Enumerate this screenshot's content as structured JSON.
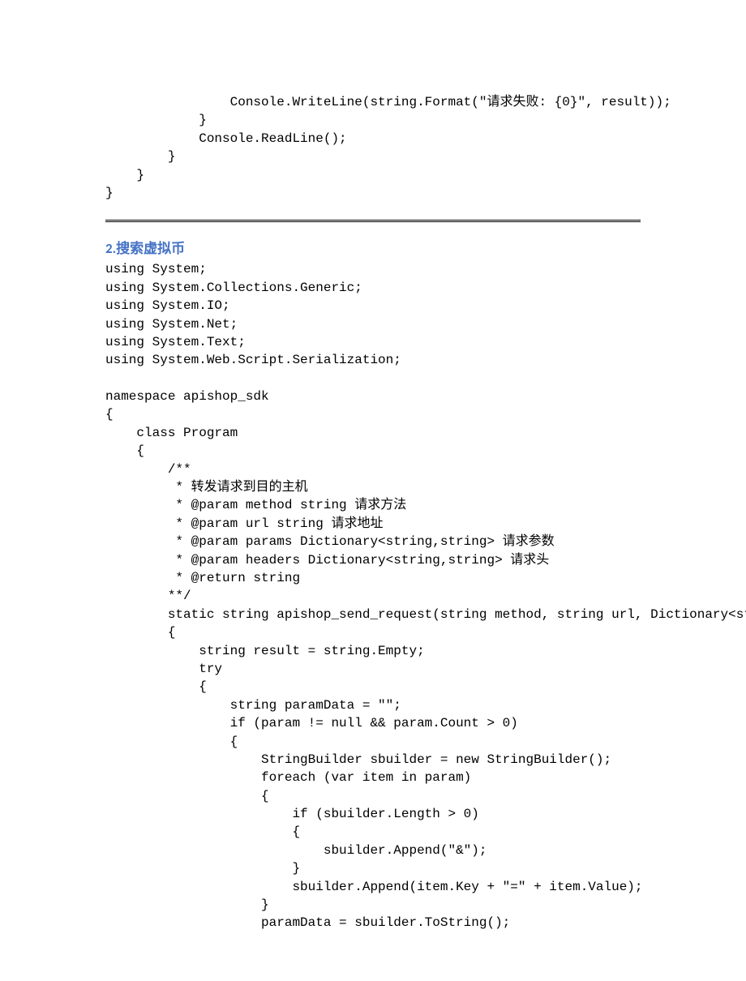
{
  "code_block_1": "                Console.WriteLine(string.Format(\"请求失败: {0}\", result));\n            }\n            Console.ReadLine();\n        }\n    }\n}",
  "section_heading": "2.搜索虚拟币",
  "code_block_2": "using System;\nusing System.Collections.Generic;\nusing System.IO;\nusing System.Net;\nusing System.Text;\nusing System.Web.Script.Serialization;\n\nnamespace apishop_sdk\n{\n    class Program\n    {\n        /**\n         * 转发请求到目的主机\n         * @param method string 请求方法\n         * @param url string 请求地址\n         * @param params Dictionary<string,string> 请求参数\n         * @param headers Dictionary<string,string> 请求头\n         * @return string\n        **/\n        static string apishop_send_request(string method, string url, Dictionary<string, string> param, Dictionary<string, string> headers)\n        {\n            string result = string.Empty;\n            try\n            {\n                string paramData = \"\";\n                if (param != null && param.Count > 0)\n                {\n                    StringBuilder sbuilder = new StringBuilder();\n                    foreach (var item in param)\n                    {\n                        if (sbuilder.Length > 0)\n                        {\n                            sbuilder.Append(\"&\");\n                        }\n                        sbuilder.Append(item.Key + \"=\" + item.Value);\n                    }\n                    paramData = sbuilder.ToString();"
}
